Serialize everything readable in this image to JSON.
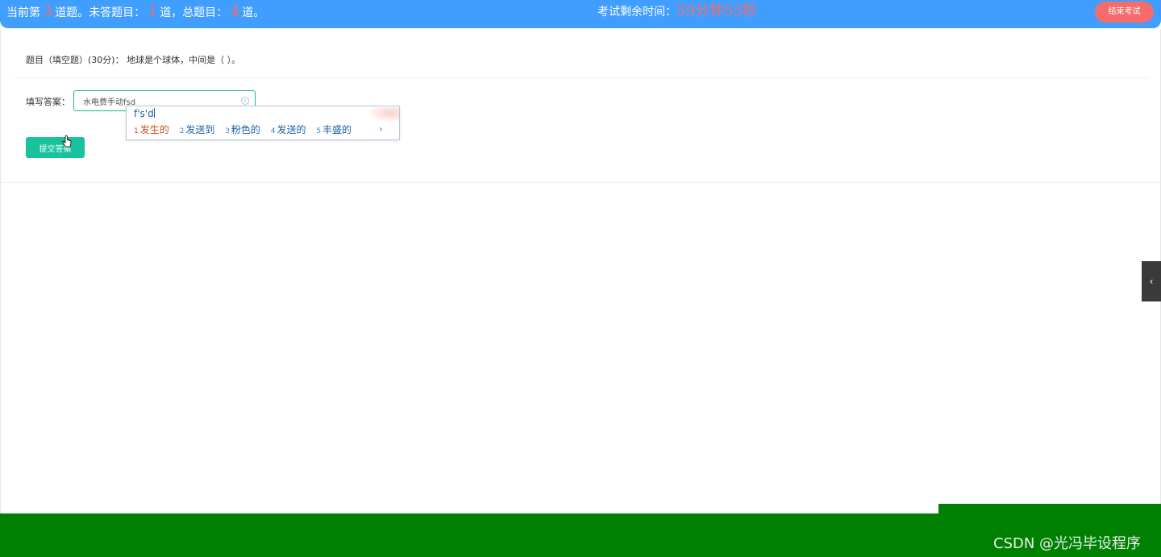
{
  "header": {
    "status_prefix": "当前第",
    "current_number": "3",
    "status_mid1": "道题。未答题目：",
    "unanswered_count": "1",
    "status_mid2": "道，总题目：",
    "total_count": "4",
    "status_suffix": "道。",
    "timer_label": "考试剩余时间：",
    "timer_value": "59分钟55秒",
    "end_button": "结束考试"
  },
  "question": {
    "text": "题目（填空题）(30分)： 地球是个球体，中间是（   ）。"
  },
  "answer": {
    "label": "填写答案：",
    "value": "水电费手动fsd",
    "submit_label": "提交答案"
  },
  "ime": {
    "pinyin": "f's'd",
    "candidates": [
      {
        "index": "1",
        "text": "发生的"
      },
      {
        "index": "2",
        "text": "发送到"
      },
      {
        "index": "3",
        "text": "粉色的"
      },
      {
        "index": "4",
        "text": "发送的"
      },
      {
        "index": "5",
        "text": "丰盛的"
      }
    ],
    "next_glyph": "›"
  },
  "side": {
    "handle_glyph": "‹"
  },
  "footer": {
    "watermark": "CSDN @光冯毕设程序"
  },
  "colors": {
    "header_bg": "#409eff",
    "accent_red": "#f56c6c",
    "submit_green": "#18c29c",
    "footer_green": "#008000"
  }
}
